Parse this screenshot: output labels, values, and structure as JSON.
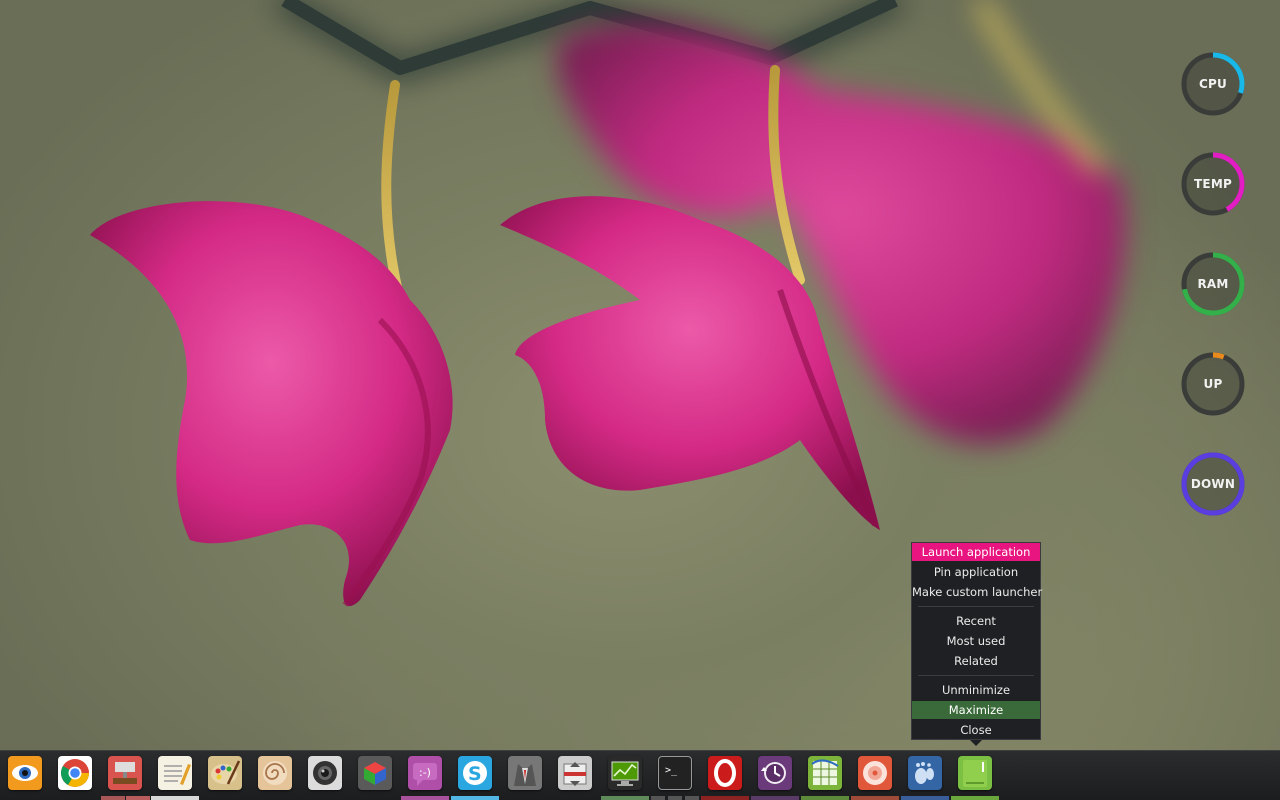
{
  "desktop": {
    "wallpaper": "pink orchid flowers on olive background"
  },
  "gauges": [
    {
      "label": "CPU",
      "color": "#18b8e8",
      "level": 0.3
    },
    {
      "label": "TEMP",
      "color": "#e21dc4",
      "level": 0.42
    },
    {
      "label": "RAM",
      "color": "#34b04a",
      "level": 0.72
    },
    {
      "label": "UP",
      "color": "#e98a1c",
      "level": 0.06
    },
    {
      "label": "DOWN",
      "color": "#5a3ee0",
      "level": 1.0
    }
  ],
  "context_menu": {
    "items": [
      {
        "label": "Launch application",
        "state": "highlighted",
        "color": "#e8147f"
      },
      {
        "label": "Pin application"
      },
      {
        "label": "Make custom launcher"
      },
      {
        "label": "Recent"
      },
      {
        "label": "Most used"
      },
      {
        "label": "Related"
      },
      {
        "label": "Unminimize"
      },
      {
        "label": "Maximize",
        "state": "hovered",
        "color": "#3a6a3a"
      },
      {
        "label": "Close"
      }
    ]
  },
  "dock": {
    "items": [
      {
        "icon": "eye-icon",
        "color": "#f29a1e"
      },
      {
        "icon": "chrome-icon",
        "color": "#4c8bf5"
      },
      {
        "icon": "network-manager-icon",
        "color": "#d9534f"
      },
      {
        "icon": "text-editor-icon",
        "color": "#f5f1e3"
      },
      {
        "icon": "paint-icon",
        "color": "#d8c08a"
      },
      {
        "icon": "shell-icon",
        "color": "#e6c49a"
      },
      {
        "icon": "camera-icon",
        "color": "#dcdcdc"
      },
      {
        "icon": "package-icon",
        "color": "#666666"
      },
      {
        "icon": "chat-icon",
        "color": "#b04fa8"
      },
      {
        "icon": "skype-icon",
        "color": "#2aa6e0"
      },
      {
        "icon": "suit-icon",
        "color": "#777777"
      },
      {
        "icon": "archive-icon",
        "color": "#cccccc"
      },
      {
        "icon": "system-monitor-icon",
        "color": "#4e9a06"
      },
      {
        "icon": "terminal-icon",
        "color": "#222222"
      },
      {
        "icon": "opera-icon",
        "color": "#cc1b1b"
      },
      {
        "icon": "time-backup-icon",
        "color": "#6b3a7a"
      },
      {
        "icon": "spreadsheet-icon",
        "color": "#7db53a"
      },
      {
        "icon": "disc-burner-icon",
        "color": "#e0573a"
      },
      {
        "icon": "gnome-foot-icon",
        "color": "#3465a4"
      },
      {
        "icon": "notes-app-icon",
        "color": "#7bc043"
      }
    ],
    "indicators": [
      {
        "item": 2,
        "color": "#a85656"
      },
      {
        "item": 3,
        "color": "#d8d8d8"
      },
      {
        "item": 8,
        "color": "#a8529e"
      },
      {
        "item": 9,
        "color": "#53b7e6"
      },
      {
        "item": 12,
        "color": "#5f8a5a"
      },
      {
        "item": 13,
        "color": "#555555"
      },
      {
        "item": 14,
        "color": "#8d2222"
      },
      {
        "item": 15,
        "color": "#5a3a66"
      },
      {
        "item": 16,
        "color": "#5d8a3a"
      },
      {
        "item": 17,
        "color": "#a04a3a"
      },
      {
        "item": 18,
        "color": "#3a5e99"
      },
      {
        "item": 19,
        "color": "#6aa83e"
      }
    ]
  }
}
